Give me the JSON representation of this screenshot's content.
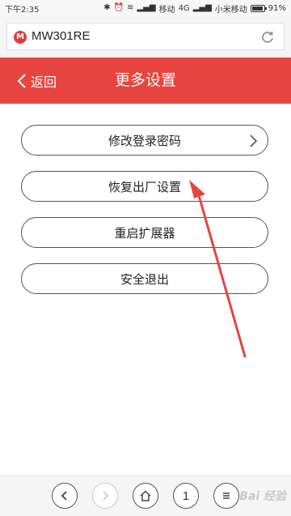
{
  "status": {
    "time": "下午2:35",
    "carrier1": "移动",
    "network1": "4G",
    "carrier2": "小米移动",
    "battery": "91%",
    "battery_level": 0.91
  },
  "browser": {
    "url_text": "MW301RE",
    "site_logo": "M"
  },
  "header": {
    "back_label": "返回",
    "title": "更多设置"
  },
  "menu": {
    "items": [
      {
        "label": "修改登录密码",
        "has_chevron": true
      },
      {
        "label": "恢复出厂设置",
        "has_chevron": false
      },
      {
        "label": "重启扩展器",
        "has_chevron": false
      },
      {
        "label": "安全退出",
        "has_chevron": false
      }
    ]
  },
  "bottom_nav": {
    "tab_count": "1",
    "watermark": "Bai 经验"
  },
  "colors": {
    "header_bg": "#e8443f",
    "annotation_arrow": "#e8443f"
  }
}
